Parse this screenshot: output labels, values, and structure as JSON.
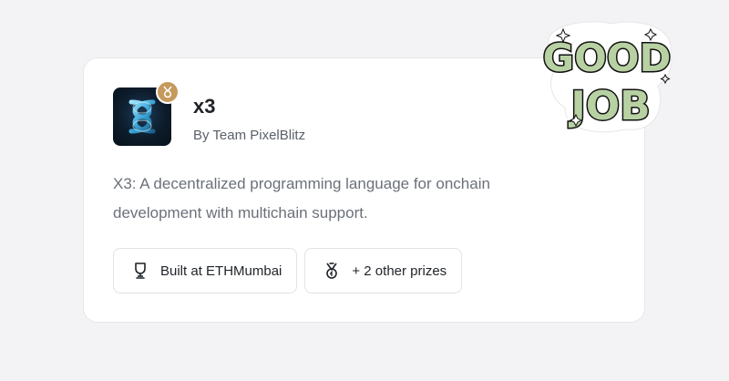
{
  "project": {
    "title": "x3",
    "byline": "By Team PixelBlitz",
    "description": "X3: A decentralized programming language for onchain development with multichain support.",
    "logo_icon": "infinity-loop-icon",
    "badge_icon": "medal-icon"
  },
  "chips": [
    {
      "icon": "trophy-icon",
      "label": "Built at ETHMumbai"
    },
    {
      "icon": "medal-icon",
      "label": "+ 2 other prizes"
    }
  ],
  "sticker": {
    "line1": "GOOD",
    "line2": "JOB"
  },
  "colors": {
    "background": "#f3f3f5",
    "card": "#ffffff",
    "badge": "#c69a5c",
    "sticker_fill": "#b8d1a3",
    "logo_glow": "#4fc3e8"
  }
}
